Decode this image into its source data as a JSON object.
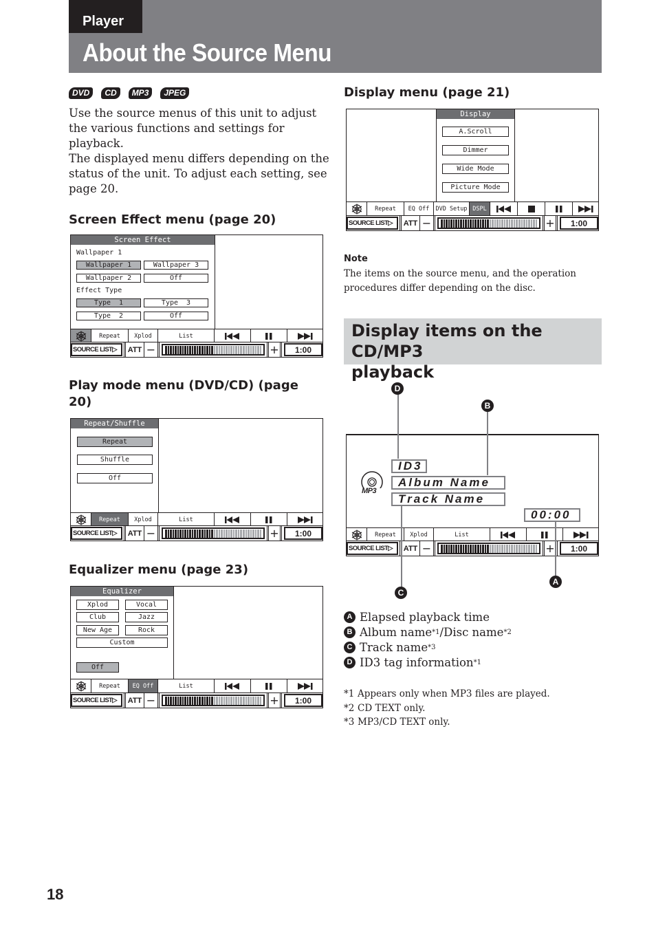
{
  "header": {
    "section": "Player",
    "title": "About the Source Menu"
  },
  "media_badges": [
    "DVD",
    "CD",
    "MP3",
    "JPEG"
  ],
  "intro": {
    "lines": [
      "Use the source menus of this unit to adjust",
      "the various functions and settings for",
      "playback.",
      "The displayed menu differs depending on the",
      "status of the unit. To adjust each setting, see",
      "page 20."
    ]
  },
  "common_controls": {
    "source_list": "SOURCE LIST▷",
    "att": "ATT",
    "minus": "−",
    "plus": "+",
    "time": "1:00",
    "volume_level": 0.5,
    "volume_segments": 40,
    "icons": {
      "settings": "snowflake-settings-icon",
      "prev": "previous-track-icon",
      "pause": "pause-icon",
      "next": "next-track-icon",
      "stop": "stop-icon"
    }
  },
  "screen_effect": {
    "heading": "Screen Effect menu (page 20)",
    "menu_title": "Screen Effect",
    "wallpaper_label": "Wallpaper 1",
    "wallpaper_options": [
      "Wallpaper 1",
      "Wallpaper 3",
      "Wallpaper 2",
      "Off"
    ],
    "wallpaper_selected": "Wallpaper 1",
    "effect_label": "Effect Type",
    "effect_options": [
      "Type  1",
      "Type  3",
      "Type  2",
      "Off"
    ],
    "effect_selected": "Type  1",
    "controls": [
      "Repeat",
      "Xplod",
      "List"
    ]
  },
  "play_mode": {
    "heading_line1": "Play mode menu (DVD/CD) (page",
    "heading_line2": "20)",
    "menu_title": "Repeat/Shuffle",
    "options": [
      "Repeat",
      "Shuffle",
      "Off"
    ],
    "selected": "Repeat",
    "controls": [
      "Repeat",
      "Xplod",
      "List"
    ],
    "active_control": "Repeat"
  },
  "equalizer": {
    "heading": "Equalizer menu (page 23)",
    "menu_title": "Equalizer",
    "options": [
      "Xplod",
      "Vocal",
      "Club",
      "Jazz",
      "New Age",
      "Rock",
      "Custom"
    ],
    "off_label": "Off",
    "selected": "Off",
    "controls": [
      "Repeat",
      "EQ Off",
      "List"
    ],
    "active_control": "EQ Off"
  },
  "display_menu": {
    "heading": "Display menu (page 21)",
    "menu_title": "Display",
    "options": [
      "A.Scroll",
      "Dimmer",
      "Wide Mode",
      "Picture Mode"
    ],
    "controls": [
      "Repeat",
      "EQ Off",
      "DVD Setup",
      "DSPL"
    ],
    "active_control": "DSPL"
  },
  "note": {
    "label": "Note",
    "lines": [
      "The items on the source menu, and the operation",
      "procedures differ depending on the disc."
    ]
  },
  "cd_mp3": {
    "heading_line1": "Display items on the CD/MP3",
    "heading_line2": "playback",
    "disc_label": "MP3",
    "id3": "ID3",
    "album": "Album Name",
    "track": "Track Name",
    "elapsed": "00:00",
    "controls": [
      "Repeat",
      "Xplod",
      "List"
    ],
    "callouts": {
      "a": "A",
      "b": "B",
      "c": "C",
      "d": "D"
    },
    "legend": [
      {
        "key": "A",
        "text": "Elapsed playback time",
        "sup": ""
      },
      {
        "key": "B",
        "text": "Album name",
        "sup": "*1",
        "text2": "/Disc name",
        "sup2": "*2"
      },
      {
        "key": "C",
        "text": "Track name",
        "sup": "*3"
      },
      {
        "key": "D",
        "text": "ID3 tag information",
        "sup": "*1"
      }
    ],
    "footnotes": [
      {
        "key": "*1",
        "text": "Appears only when MP3 files are played."
      },
      {
        "key": "*2",
        "text": "CD TEXT only."
      },
      {
        "key": "*3",
        "text": "MP3/CD TEXT only."
      }
    ]
  },
  "page_number": "18"
}
